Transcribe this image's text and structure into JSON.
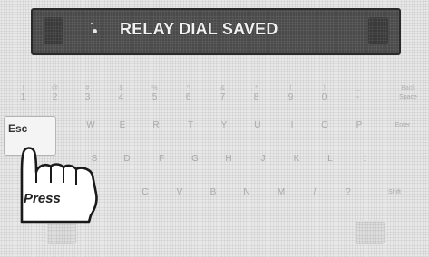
{
  "display": {
    "message": "RELAY DIAL SAVED",
    "screen_color": "#4a4a4a",
    "text_color": "#f2f2f2"
  },
  "keyboard": {
    "row1": [
      {
        "top": "!",
        "main": "1"
      },
      {
        "top": "@",
        "main": "2"
      },
      {
        "top": "#",
        "main": "3"
      },
      {
        "top": "$",
        "main": "4"
      },
      {
        "top": "%",
        "main": "5"
      },
      {
        "top": "^",
        "main": "6"
      },
      {
        "top": "&",
        "main": "7"
      },
      {
        "top": "*",
        "main": "8"
      },
      {
        "top": "(",
        "main": "9"
      },
      {
        "top": ")",
        "main": "0"
      },
      {
        "top": "_",
        "main": "-"
      },
      {
        "top": "Back",
        "main": "Space"
      }
    ],
    "row2": [
      "W",
      "E",
      "R",
      "T",
      "Y",
      "U",
      "I",
      "O",
      "P",
      "Enter"
    ],
    "row3": [
      "S",
      "D",
      "F",
      "G",
      "H",
      "J",
      "K",
      "L",
      ":"
    ],
    "row4": [
      "C",
      "V",
      "B",
      "N",
      "M",
      "/",
      "?",
      "Shift"
    ],
    "esc_label": "Esc"
  },
  "hint": {
    "label": "Press",
    "icon": "pointing-hand-icon"
  }
}
